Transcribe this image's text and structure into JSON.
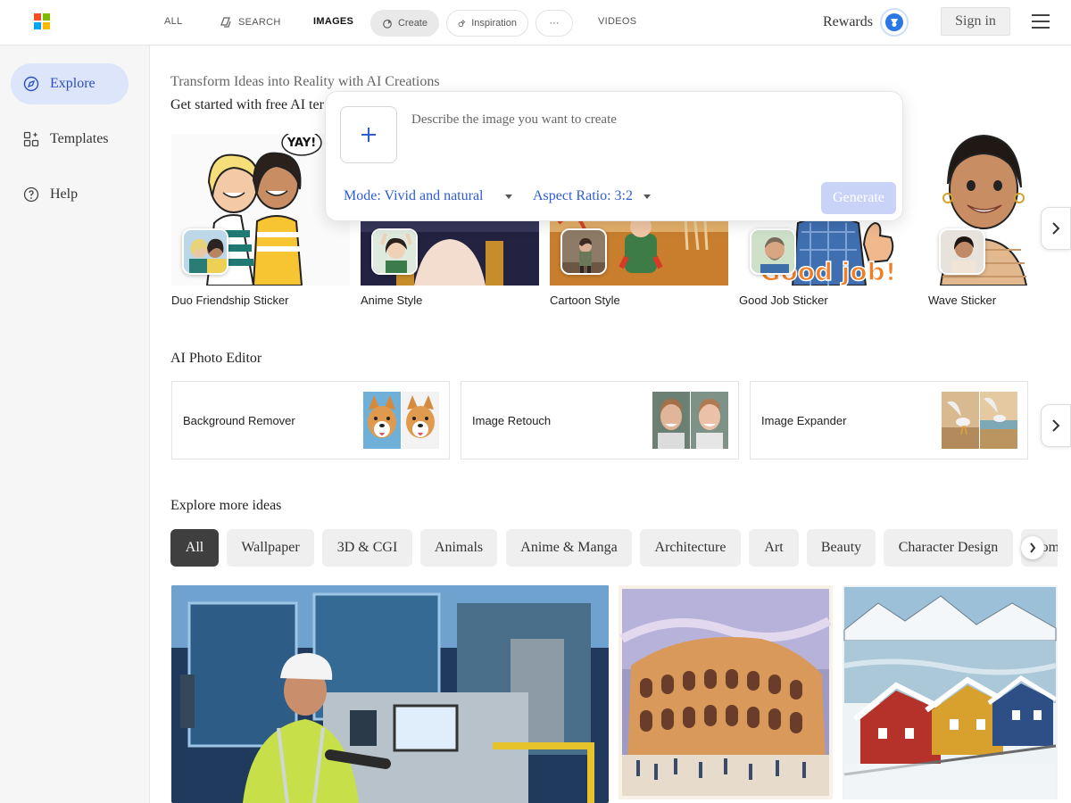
{
  "header": {
    "nav": {
      "all": "ALL",
      "search": "SEARCH",
      "images": "IMAGES",
      "create": "Create",
      "inspiration": "Inspiration",
      "more": "···",
      "videos": "VIDEOS"
    },
    "rewards_label": "Rewards",
    "signin_label": "Sign in",
    "logo_colors": [
      "#f25022",
      "#7fba00",
      "#00a4ef",
      "#ffb900"
    ],
    "accent_color": "#2f5bd4"
  },
  "sidebar": {
    "items": [
      {
        "label": "Explore",
        "icon": "compass-icon",
        "active": true
      },
      {
        "label": "Templates",
        "icon": "templates-icon",
        "active": false
      },
      {
        "label": "Help",
        "icon": "help-icon",
        "active": false
      }
    ]
  },
  "main": {
    "subtitle": "Transform Ideas into Reality with AI Creations",
    "templates_heading": "Get started with free AI ter",
    "templates": [
      {
        "label": "Duo Friendship Sticker"
      },
      {
        "label": "Anime Style"
      },
      {
        "label": "Cartoon Style"
      },
      {
        "label": "Good Job Sticker"
      },
      {
        "label": "Wave Sticker"
      }
    ],
    "sticker_texts": {
      "yay": "YAY!",
      "good_job": "Good job!"
    },
    "create": {
      "placeholder": "Describe the image you want to create",
      "mode_label": "Mode: Vivid and natural",
      "aspect_label": "Aspect Ratio: 3:2",
      "generate_label": "Generate"
    },
    "editor_heading": "AI Photo Editor",
    "editor_tools": [
      {
        "label": "Background Remover"
      },
      {
        "label": "Image Retouch"
      },
      {
        "label": "Image Expander"
      }
    ],
    "explore_heading": "Explore more ideas",
    "categories": [
      "All",
      "Wallpaper",
      "3D & CGI",
      "Animals",
      "Anime & Manga",
      "Architecture",
      "Art",
      "Beauty",
      "Character Design",
      "Comics"
    ],
    "active_category": "All"
  }
}
